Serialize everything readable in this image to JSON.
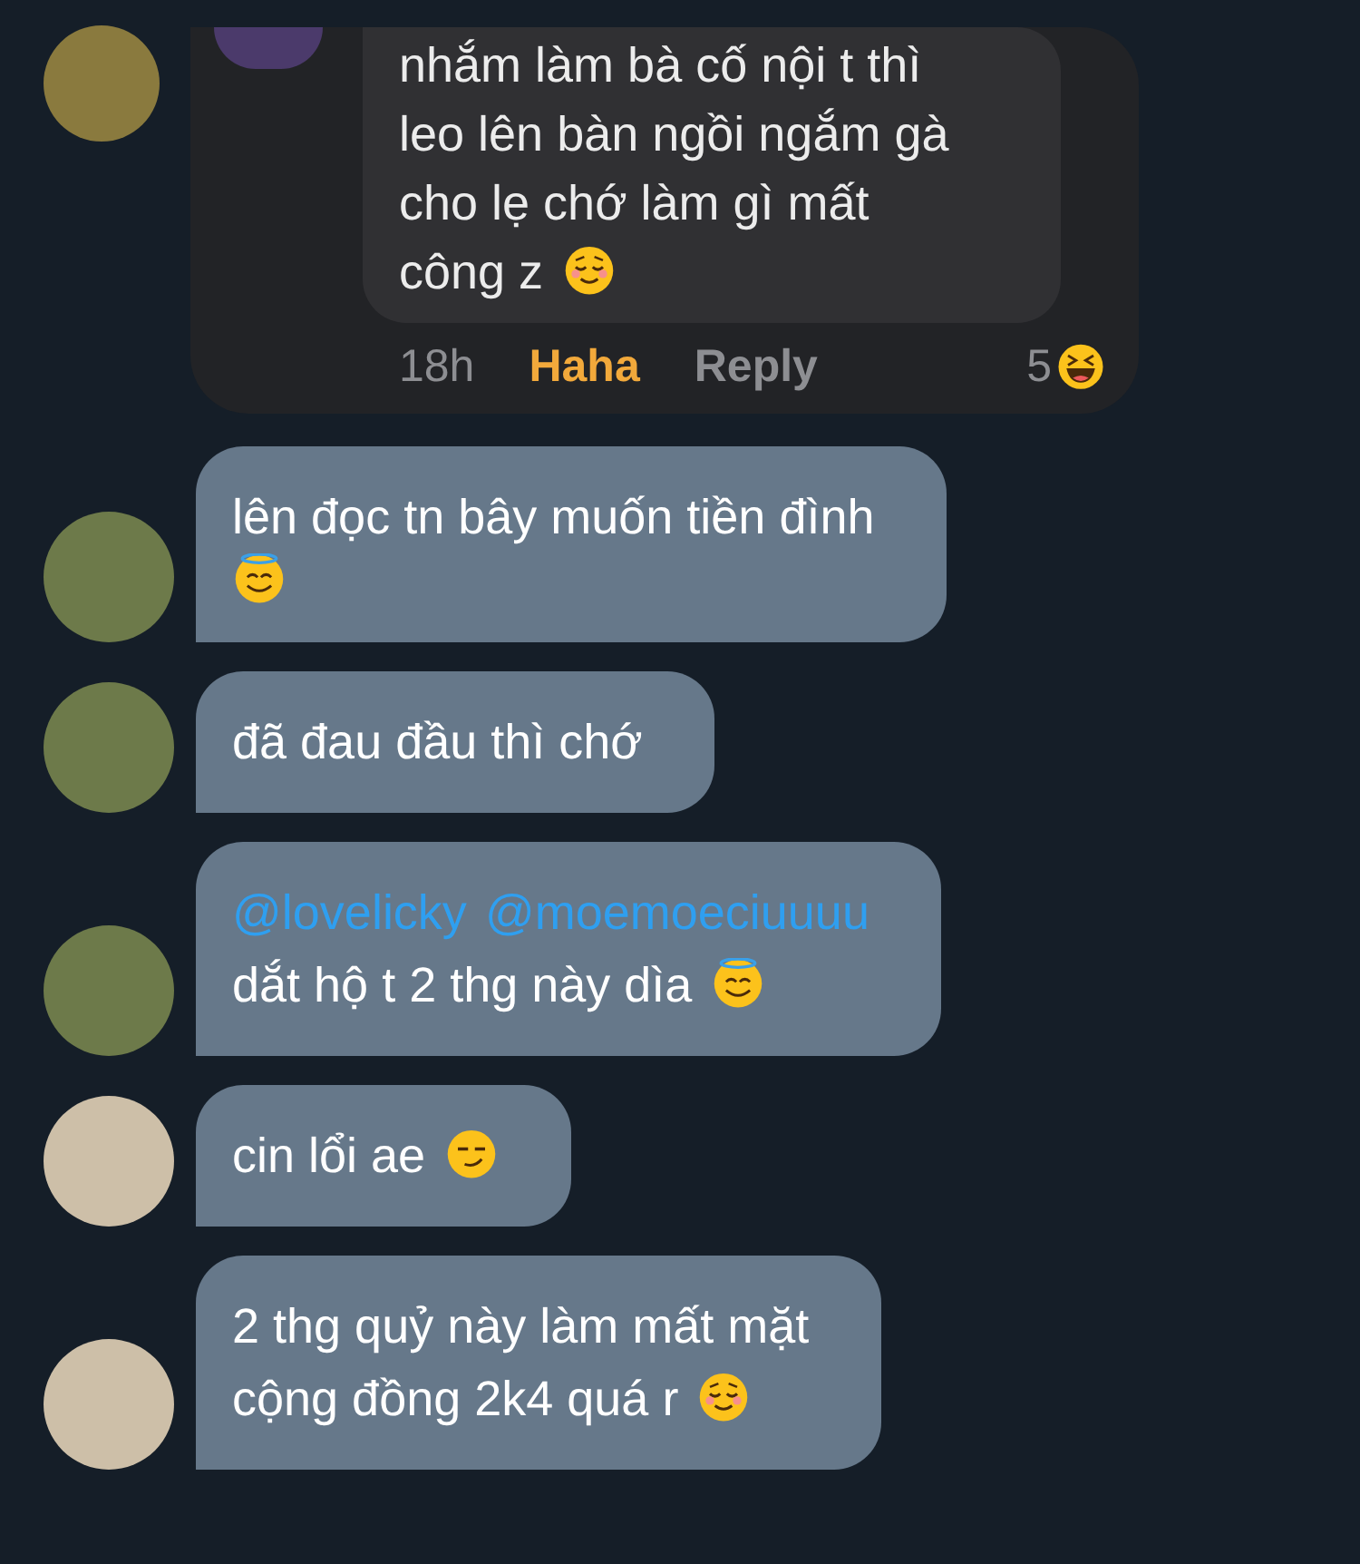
{
  "reply_card": {
    "lines": [
      [
        {
          "kind": "text",
          "text": "nhắm làm bà cố nội t thì"
        }
      ],
      [
        {
          "kind": "text",
          "text": "leo lên bàn ngồi ngắm gà"
        }
      ],
      [
        {
          "kind": "text",
          "text": "cho lẹ chớ làm gì mất"
        }
      ],
      [
        {
          "kind": "text",
          "text": "công z"
        },
        {
          "kind": "relieved"
        }
      ]
    ],
    "time": "18h",
    "reaction_label": "Haha",
    "reacted": true,
    "reply": "Reply",
    "reaction_count": "5",
    "reaction_icon": {
      "kind": "laughing"
    }
  },
  "comments": [
    {
      "avatar": {
        "kind": "dark"
      },
      "lines": [
        [
          {
            "kind": "text",
            "text": "lên đọc tn bây muốn tiền đình"
          }
        ],
        [
          {
            "kind": "halo"
          }
        ]
      ]
    },
    {
      "avatar": {
        "kind": "dark"
      },
      "lines": [
        [
          {
            "kind": "text",
            "text": "đã đau đầu thì chớ"
          }
        ]
      ]
    },
    {
      "avatar": {
        "kind": "dark"
      },
      "lines": [
        [
          {
            "kind": "mention",
            "text": "@lovelicky"
          },
          {
            "kind": "mention",
            "text": "@moemoeciuuuu"
          }
        ],
        [
          {
            "kind": "text",
            "text": "dắt hộ t 2 thg này dìa"
          },
          {
            "kind": "halo"
          }
        ]
      ]
    },
    {
      "avatar": {
        "kind": "light"
      },
      "lines": [
        [
          {
            "kind": "text",
            "text": "cin lổi ae"
          },
          {
            "kind": "smirk"
          }
        ]
      ]
    },
    {
      "avatar": {
        "kind": "light"
      },
      "lines": [
        [
          {
            "kind": "text",
            "text": "2 thg quỷ này làm mất mặt"
          }
        ],
        [
          {
            "kind": "text",
            "text": "cộng đồng 2k4 quá r"
          },
          {
            "kind": "relieved"
          }
        ]
      ]
    }
  ]
}
